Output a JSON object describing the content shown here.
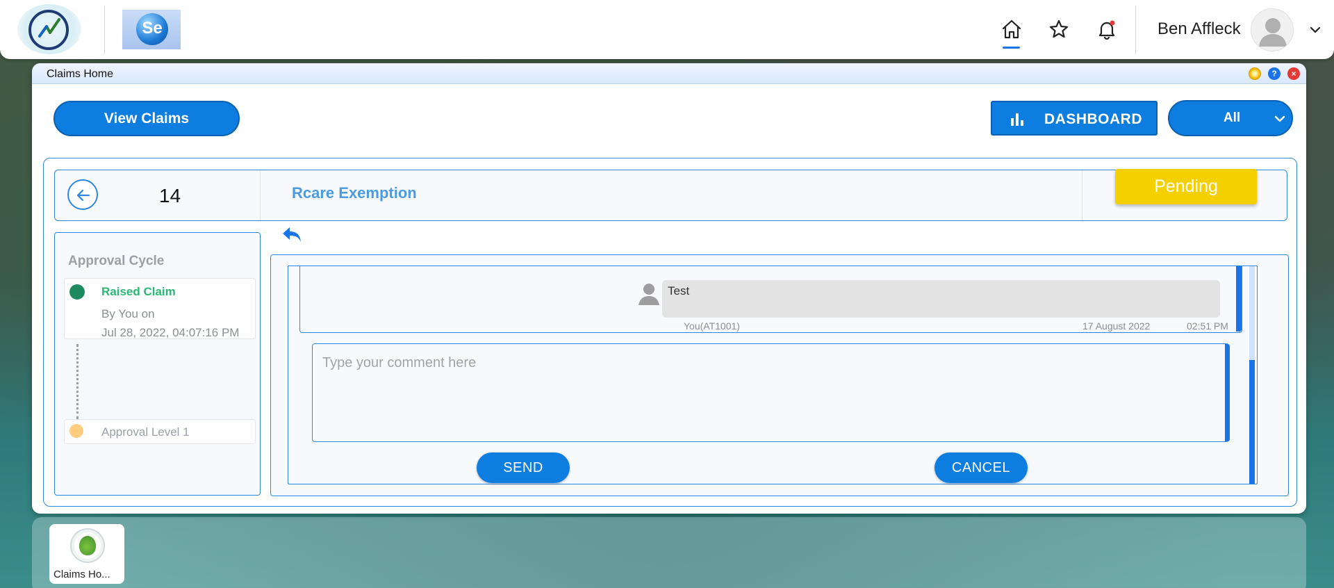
{
  "header": {
    "user_name": "Ben Affleck",
    "logo_text": "Se",
    "nav": [
      {
        "name": "home",
        "icon": "home-icon",
        "active": true
      },
      {
        "name": "favorites",
        "icon": "star-icon"
      },
      {
        "name": "notifications",
        "icon": "bell-icon",
        "has_badge": true
      }
    ]
  },
  "window": {
    "title": "Claims Home"
  },
  "toolbar": {
    "view_claims_label": "View Claims",
    "dashboard_label": "DASHBOARD",
    "filter_value": "All"
  },
  "claim": {
    "id": "14",
    "type": "Rcare Exemption",
    "status": "Pending"
  },
  "approval_cycle": {
    "title": "Approval Cycle",
    "steps": [
      {
        "title": "Raised Claim",
        "by": "By You on",
        "date": "Jul 28, 2022, 04:07:16 PM",
        "color": "#1e8a5e",
        "title_color": "#2bb673"
      },
      {
        "title": "Approval Level 1",
        "color": "#ffcc80",
        "title_color": "#9aa0a6"
      }
    ]
  },
  "comments": {
    "messages": [
      {
        "text": "Test",
        "author": "You(AT1001)",
        "date": "17 August 2022",
        "time": "02:51 PM"
      }
    ],
    "input_placeholder": "Type your comment here",
    "send_label": "SEND",
    "cancel_label": "CANCEL"
  },
  "taskbar": {
    "items": [
      {
        "label": "Claims Ho...",
        "icon": "claims-app-icon"
      }
    ]
  },
  "colors": {
    "accent": "#0d7de0",
    "border": "#2e86de",
    "pending": "#f5d000"
  }
}
